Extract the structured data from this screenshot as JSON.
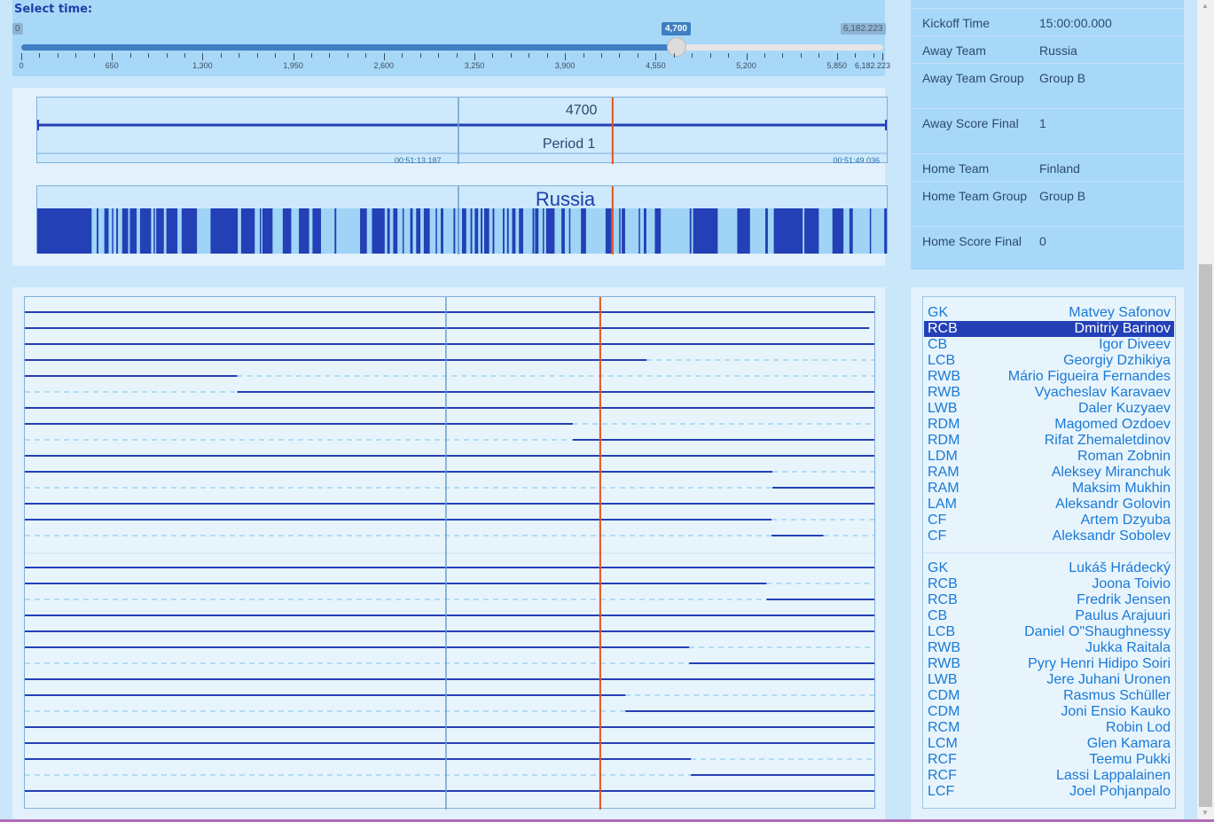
{
  "slider": {
    "title": "Select time:",
    "min_label": "0",
    "max_label": "6,182.223",
    "current_label": "4,700",
    "min": 0,
    "max": 6182.223,
    "value": 4700,
    "tick_labels": [
      {
        "value": 0,
        "label": "0"
      },
      {
        "value": 650,
        "label": "650"
      },
      {
        "value": 1300,
        "label": "1,300"
      },
      {
        "value": 1950,
        "label": "1,950"
      },
      {
        "value": 2600,
        "label": "2,600"
      },
      {
        "value": 3250,
        "label": "3,250"
      },
      {
        "value": 3900,
        "label": "3,900"
      },
      {
        "value": 4550,
        "label": "4,550"
      },
      {
        "value": 5200,
        "label": "5,200"
      },
      {
        "value": 5850,
        "label": "5,850"
      },
      {
        "value": 6182.223,
        "label": "6,182.223"
      }
    ]
  },
  "timeline": {
    "current_time": "4700",
    "period_label": "Period 1",
    "window_start": 1589,
    "window_end": 6182.223,
    "divider_value": 3866,
    "left_clock": "00:51:13.187",
    "right_clock": "00:51:49.036",
    "team_label": "Russia",
    "possession_segments": [
      [
        0.0,
        0.064
      ],
      [
        0.07,
        0.072
      ],
      [
        0.079,
        0.084
      ],
      [
        0.088,
        0.089
      ],
      [
        0.093,
        0.095
      ],
      [
        0.1,
        0.107
      ],
      [
        0.109,
        0.117
      ],
      [
        0.121,
        0.134
      ],
      [
        0.137,
        0.138
      ],
      [
        0.14,
        0.149
      ],
      [
        0.152,
        0.165
      ],
      [
        0.17,
        0.188
      ],
      [
        0.204,
        0.236
      ],
      [
        0.24,
        0.256
      ],
      [
        0.262,
        0.263
      ],
      [
        0.265,
        0.277
      ],
      [
        0.289,
        0.299
      ],
      [
        0.308,
        0.32
      ],
      [
        0.324,
        0.334
      ],
      [
        0.35,
        0.352
      ],
      [
        0.38,
        0.388
      ],
      [
        0.394,
        0.409
      ],
      [
        0.412,
        0.415
      ],
      [
        0.419,
        0.424
      ],
      [
        0.43,
        0.431
      ],
      [
        0.439,
        0.442
      ],
      [
        0.446,
        0.451
      ],
      [
        0.455,
        0.462
      ],
      [
        0.469,
        0.47
      ],
      [
        0.475,
        0.478
      ],
      [
        0.49,
        0.492
      ],
      [
        0.495,
        0.496
      ],
      [
        0.5,
        0.505
      ],
      [
        0.51,
        0.512
      ],
      [
        0.515,
        0.519
      ],
      [
        0.522,
        0.524
      ],
      [
        0.526,
        0.532
      ],
      [
        0.536,
        0.538
      ],
      [
        0.548,
        0.55
      ],
      [
        0.553,
        0.555
      ],
      [
        0.559,
        0.563
      ],
      [
        0.567,
        0.572
      ],
      [
        0.583,
        0.585
      ],
      [
        0.586,
        0.59
      ],
      [
        0.595,
        0.596
      ],
      [
        0.599,
        0.609
      ],
      [
        0.617,
        0.621
      ],
      [
        0.626,
        0.627
      ],
      [
        0.64,
        0.646
      ],
      [
        0.669,
        0.676
      ],
      [
        0.685,
        0.686
      ],
      [
        0.688,
        0.692
      ],
      [
        0.708,
        0.709
      ],
      [
        0.714,
        0.717
      ],
      [
        0.727,
        0.734
      ],
      [
        0.768,
        0.77
      ],
      [
        0.772,
        0.801
      ],
      [
        0.824,
        0.839
      ],
      [
        0.857,
        0.86
      ],
      [
        0.867,
        0.901
      ],
      [
        0.903,
        0.92
      ],
      [
        0.936,
        0.949
      ],
      [
        0.956,
        0.96
      ],
      [
        0.98,
        0.981
      ],
      [
        0.997,
        1.0
      ]
    ]
  },
  "lanes": {
    "home_away_groups": [
      [
        {
          "solid": [
            [
              0,
              1
            ]
          ]
        },
        {
          "solid": [
            [
              0,
              0.994
            ]
          ]
        },
        {
          "solid": [
            [
              0,
              1
            ]
          ]
        },
        {
          "solid": [
            [
              0,
              0.732
            ]
          ],
          "dashed": [
            [
              0.732,
              1
            ]
          ]
        },
        {
          "solid": [
            [
              0,
              0.25
            ]
          ],
          "dashed": [
            [
              0.25,
              1
            ]
          ]
        },
        {
          "dashed": [
            [
              0,
              0.25
            ]
          ],
          "solid": [
            [
              0.25,
              1
            ]
          ]
        },
        {
          "solid": [
            [
              0,
              1
            ]
          ]
        },
        {
          "solid": [
            [
              0,
              0.645
            ]
          ],
          "dashed": [
            [
              0.645,
              1
            ]
          ]
        },
        {
          "dashed": [
            [
              0,
              0.645
            ]
          ],
          "solid": [
            [
              0.645,
              1
            ]
          ]
        },
        {
          "solid": [
            [
              0,
              1
            ]
          ]
        },
        {
          "solid": [
            [
              0,
              0.88
            ]
          ],
          "dashed": [
            [
              0.88,
              1
            ]
          ]
        },
        {
          "dashed": [
            [
              0,
              0.88
            ]
          ],
          "solid": [
            [
              0.88,
              1
            ]
          ]
        },
        {
          "solid": [
            [
              0,
              1
            ]
          ]
        },
        {
          "solid": [
            [
              0,
              0.879
            ]
          ],
          "dashed": [
            [
              0.879,
              1
            ]
          ]
        },
        {
          "dashed": [
            [
              0,
              0.879
            ]
          ],
          "solid": [
            [
              0.879,
              0.94
            ]
          ],
          "dashed2": [
            [
              0.94,
              1
            ]
          ]
        }
      ],
      [
        {
          "solid": [
            [
              0,
              1
            ]
          ]
        },
        {
          "solid": [
            [
              0,
              0.873
            ]
          ],
          "dashed": [
            [
              0.873,
              1
            ]
          ]
        },
        {
          "dashed": [
            [
              0,
              0.873
            ]
          ],
          "solid": [
            [
              0.873,
              1
            ]
          ]
        },
        {
          "solid": [
            [
              0,
              1
            ]
          ]
        },
        {
          "solid": [
            [
              0,
              1
            ]
          ]
        },
        {
          "solid": [
            [
              0,
              0.782
            ]
          ],
          "dashed": [
            [
              0.782,
              1
            ]
          ]
        },
        {
          "dashed": [
            [
              0,
              0.782
            ]
          ],
          "solid": [
            [
              0.782,
              1
            ]
          ]
        },
        {
          "solid": [
            [
              0,
              1
            ]
          ]
        },
        {
          "solid": [
            [
              0,
              0.707
            ]
          ],
          "dashed": [
            [
              0.707,
              1
            ]
          ]
        },
        {
          "dashed": [
            [
              0,
              0.707
            ]
          ],
          "solid": [
            [
              0.707,
              1
            ]
          ]
        },
        {
          "solid": [
            [
              0,
              1
            ]
          ]
        },
        {
          "solid": [
            [
              0,
              1
            ]
          ]
        },
        {
          "solid": [
            [
              0,
              0.784
            ]
          ],
          "dashed": [
            [
              0.784,
              1
            ]
          ]
        },
        {
          "dashed": [
            [
              0,
              0.784
            ]
          ],
          "solid": [
            [
              0.784,
              1
            ]
          ]
        },
        {
          "solid": [
            [
              0,
              1
            ]
          ]
        }
      ]
    ]
  },
  "match_info": [
    {
      "key": "Kickoff Time",
      "value": "15:00:00.000"
    },
    {
      "key": "Away Team",
      "value": "Russia"
    },
    {
      "key": "Away Team Group",
      "value": "Group B"
    },
    {
      "key": "Away Score Final",
      "value": "1"
    },
    {
      "key": "Home Team",
      "value": "Finland"
    },
    {
      "key": "Home Team Group",
      "value": "Group B"
    },
    {
      "key": "Home Score Final",
      "value": "0"
    }
  ],
  "roster": {
    "away": [
      {
        "pos": "GK",
        "name": "Matvey Safonov"
      },
      {
        "pos": "RCB",
        "name": "Dmitriy Barinov",
        "selected": true
      },
      {
        "pos": "CB",
        "name": "Igor Diveev"
      },
      {
        "pos": "LCB",
        "name": "Georgiy Dzhikiya"
      },
      {
        "pos": "RWB",
        "name": "Mário Figueira Fernandes"
      },
      {
        "pos": "RWB",
        "name": "Vyacheslav Karavaev"
      },
      {
        "pos": "LWB",
        "name": "Daler Kuzyaev"
      },
      {
        "pos": "RDM",
        "name": "Magomed Ozdoev"
      },
      {
        "pos": "RDM",
        "name": "Rifat Zhemaletdinov"
      },
      {
        "pos": "LDM",
        "name": "Roman Zobnin"
      },
      {
        "pos": "RAM",
        "name": "Aleksey Miranchuk"
      },
      {
        "pos": "RAM",
        "name": "Maksim Mukhin"
      },
      {
        "pos": "LAM",
        "name": "Aleksandr Golovin"
      },
      {
        "pos": "CF",
        "name": "Artem Dzyuba"
      },
      {
        "pos": "CF",
        "name": "Aleksandr Sobolev"
      }
    ],
    "home": [
      {
        "pos": "GK",
        "name": "Lukáš Hrádecký"
      },
      {
        "pos": "RCB",
        "name": "Joona Toivio"
      },
      {
        "pos": "RCB",
        "name": "Fredrik Jensen"
      },
      {
        "pos": "CB",
        "name": "Paulus Arajuuri"
      },
      {
        "pos": "LCB",
        "name": "Daniel O\"Shaughnessy"
      },
      {
        "pos": "RWB",
        "name": "Jukka Raitala"
      },
      {
        "pos": "RWB",
        "name": "Pyry Henri Hidipo Soiri"
      },
      {
        "pos": "LWB",
        "name": "Jere Juhani Uronen"
      },
      {
        "pos": "CDM",
        "name": "Rasmus Schüller"
      },
      {
        "pos": "CDM",
        "name": "Joni Ensio Kauko"
      },
      {
        "pos": "RCM",
        "name": "Robin Lod"
      },
      {
        "pos": "LCM",
        "name": "Glen Kamara"
      },
      {
        "pos": "RCF",
        "name": "Teemu Pukki"
      },
      {
        "pos": "RCF",
        "name": "Lassi Lappalainen"
      },
      {
        "pos": "LCF",
        "name": "Joel Pohjanpalo"
      }
    ]
  },
  "colors": {
    "marker": "#e8501e",
    "lane_solid": "#2340b6",
    "lane_dashed": "#9fd4ef",
    "possession": "#2340b6"
  }
}
